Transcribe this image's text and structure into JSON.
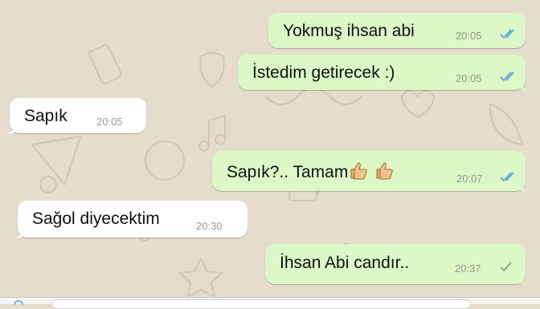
{
  "theme": {
    "outgoing_bubble": "#dcf8c6",
    "incoming_bubble": "#ffffff",
    "wallpaper": "#e6dccb",
    "read_tick_color": "#4fa3e3",
    "sent_tick_color": "#8e9a86"
  },
  "messages": [
    {
      "direction": "outgoing",
      "text": "Yokmuş ihsan abi",
      "time": "20:05",
      "status": "read"
    },
    {
      "direction": "outgoing",
      "text": "İstedim getirecek :)",
      "time": "20:05",
      "status": "read"
    },
    {
      "direction": "incoming",
      "text": "Sapık",
      "time": "20:05"
    },
    {
      "direction": "outgoing",
      "text": "Sapık?.. Tamam",
      "emoji": [
        "thumbs-up",
        "thumbs-up"
      ],
      "time": "20:07",
      "status": "read"
    },
    {
      "direction": "incoming",
      "text": "Sağol diyecektim",
      "time": "20:30"
    },
    {
      "direction": "outgoing",
      "text": "İhsan Abi candır..",
      "time": "20:37",
      "status": "sent"
    }
  ],
  "icons": {
    "read_ticks": "double-check-icon",
    "sent_tick": "single-check-icon",
    "emoji": "thumbs-up-icon",
    "attach": "camera-icon"
  }
}
